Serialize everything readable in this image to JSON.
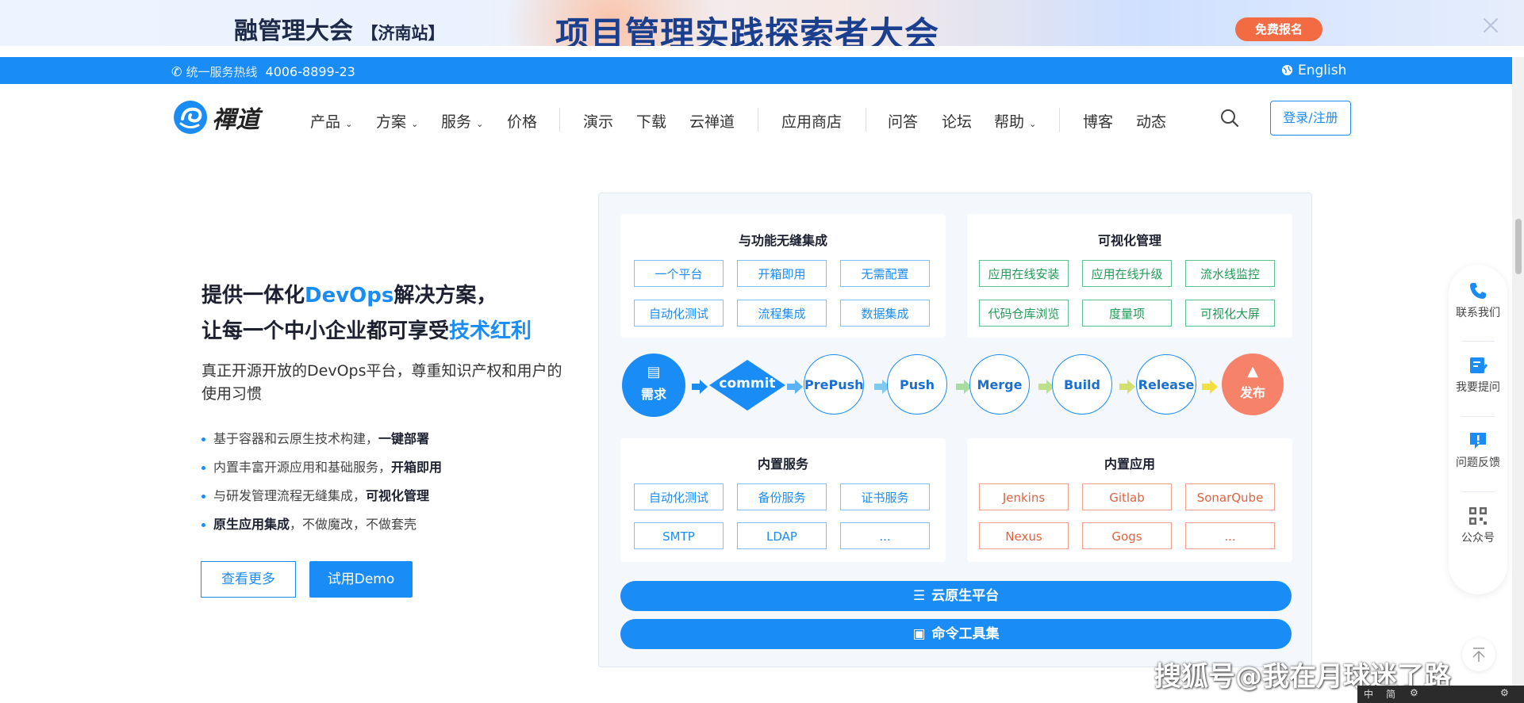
{
  "banner": {
    "left_title": "融管理大会",
    "left_sub": "【济南站】",
    "center_title": "项目管理实践探索者大会",
    "button": "免费报名"
  },
  "topbar": {
    "hotline_label": "统一服务热线",
    "hotline_number": "4006-8899-23",
    "language": "English"
  },
  "nav": {
    "logo_text": "禪道",
    "items": [
      "产品",
      "方案",
      "服务",
      "价格",
      "演示",
      "下载",
      "云禅道",
      "应用商店",
      "问答",
      "论坛",
      "帮助",
      "博客",
      "动态"
    ],
    "login": "登录/注册"
  },
  "hero": {
    "line1_pre": "提供一体化",
    "line1_hl": "DevOps",
    "line1_post": "解决方案，",
    "line2_pre": "让每一个中小企业都可享受",
    "line2_hl": "技术红利",
    "desc": "真正开源开放的DevOps平台，尊重知识产权和用户的使用习惯",
    "features": [
      {
        "text": "基于容器和云原生技术构建，",
        "bold": "一键部署"
      },
      {
        "text": "内置丰富开源应用和基础服务，",
        "bold": "开箱即用"
      },
      {
        "text": "与研发管理流程无缝集成，",
        "bold": "可视化管理"
      },
      {
        "bold": "原生应用集成",
        "text": "，不做魔改，不做套壳"
      }
    ],
    "btn_more": "查看更多",
    "btn_demo": "试用Demo"
  },
  "diagram": {
    "card1": {
      "title": "与功能无缝集成",
      "tags": [
        "一个平台",
        "开箱即用",
        "无需配置",
        "自动化测试",
        "流程集成",
        "数据集成"
      ]
    },
    "card2": {
      "title": "可视化管理",
      "tags": [
        "应用在线安装",
        "应用在线升级",
        "流水线监控",
        "代码仓库浏览",
        "度量项",
        "可视化大屏"
      ]
    },
    "pipeline": {
      "start": "需求",
      "commit": "commit",
      "steps": [
        "PrePush",
        "Push",
        "Merge",
        "Build",
        "Release"
      ],
      "end": "发布"
    },
    "card3": {
      "title": "内置服务",
      "tags": [
        "自动化测试",
        "备份服务",
        "证书服务",
        "SMTP",
        "LDAP",
        "..."
      ]
    },
    "card4": {
      "title": "内置应用",
      "tags": [
        "Jenkins",
        "Gitlab",
        "SonarQube",
        "Nexus",
        "Gogs",
        "..."
      ]
    },
    "bar1": "云原生平台",
    "bar2": "命令工具集"
  },
  "sidebar": {
    "items": [
      "联系我们",
      "我要提问",
      "问题反馈",
      "公众号"
    ]
  },
  "watermark": "搜狐号@我在月球迷了路",
  "tray": [
    "中",
    "简"
  ],
  "colors": {
    "brand": "#1a8cf5",
    "accent_orange": "#f26b43",
    "green": "#1e9b55",
    "red": "#e0623f"
  }
}
